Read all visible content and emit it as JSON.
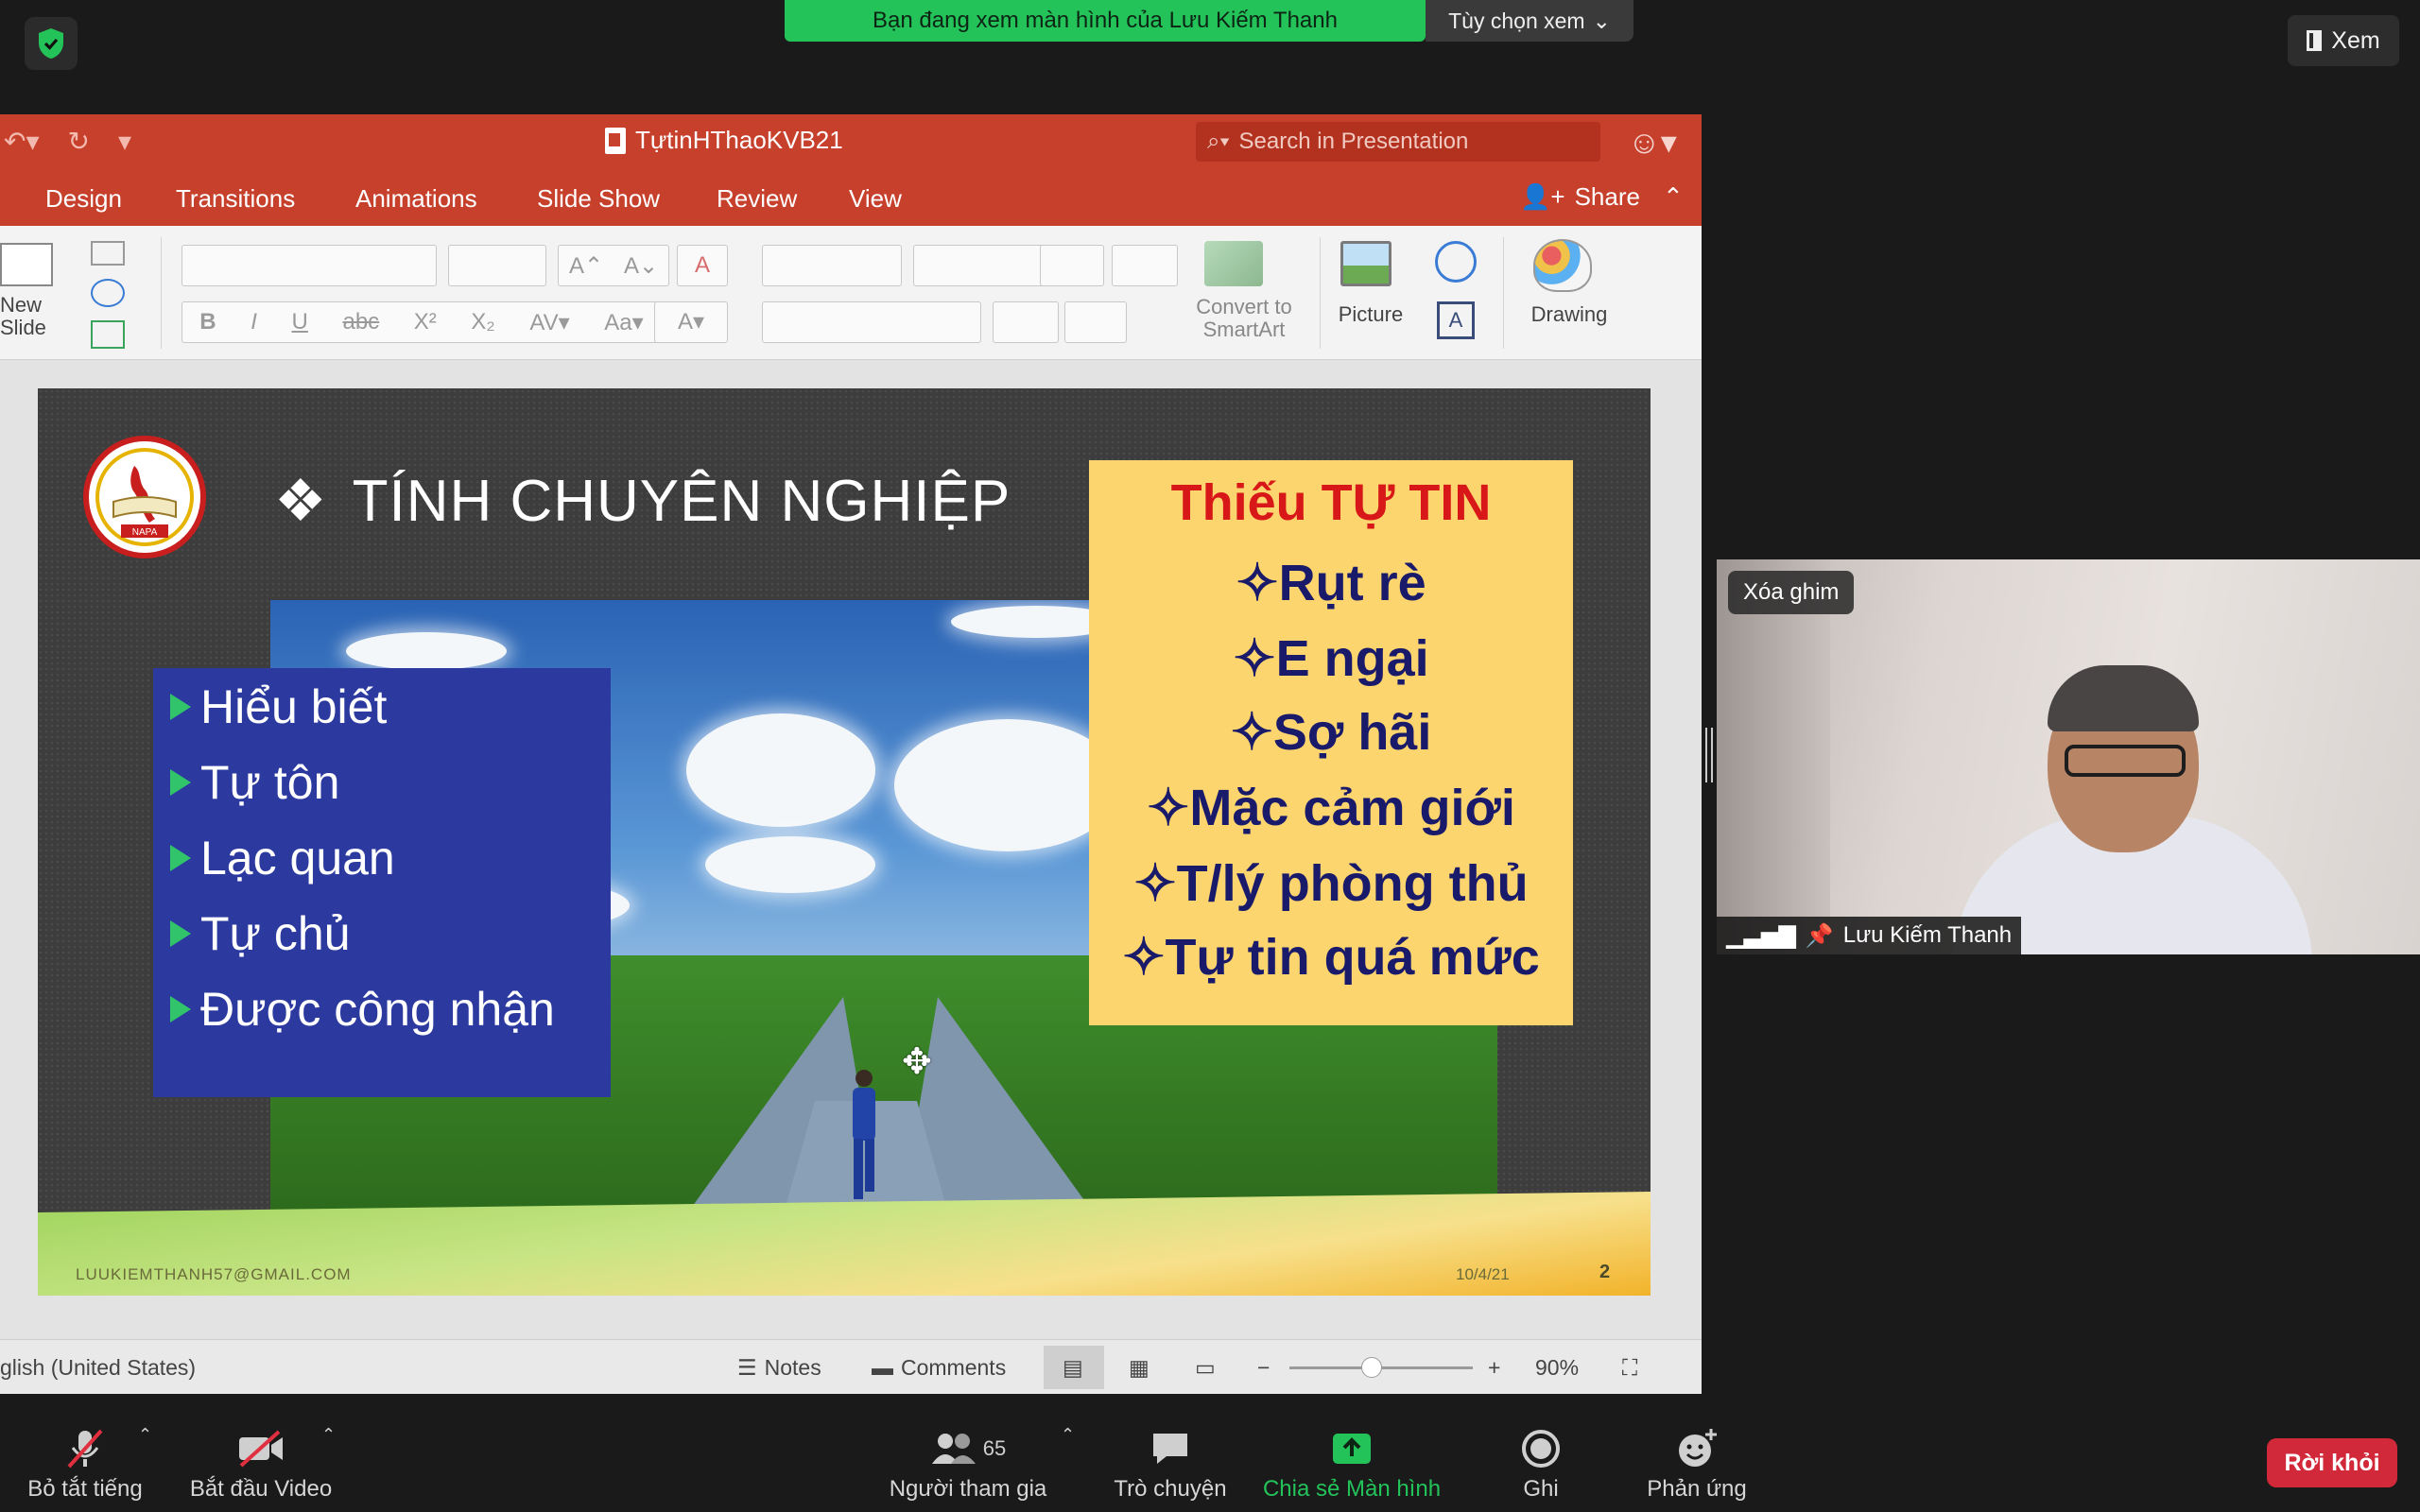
{
  "zoom": {
    "banner_text": "Bạn đang xem màn hình của Lưu Kiếm Thanh",
    "view_options": "Tùy chọn xem",
    "view_button": "Xem",
    "toolbar": {
      "mute": "Bỏ tắt tiếng",
      "video": "Bắt đầu Video",
      "participants": "Người tham gia",
      "participants_count": "65",
      "chat": "Trò chuyện",
      "share": "Chia sẻ Màn hình",
      "record": "Ghi",
      "reactions": "Phản ứng",
      "leave": "Rời khỏi"
    },
    "video_tile": {
      "unpin": "Xóa ghim",
      "name": "Lưu Kiếm Thanh"
    },
    "colors": {
      "banner": "#23c35a",
      "leave": "#d2293a",
      "share_icon": "#23c35a"
    }
  },
  "ppt": {
    "title": "TựtinHThaoKVB21",
    "search_placeholder": "Search in Presentation",
    "tabs": [
      "Design",
      "Transitions",
      "Animations",
      "Slide Show",
      "Review",
      "View"
    ],
    "share": "Share",
    "ribbon": {
      "new_slide": "New Slide",
      "convert": "Convert to SmartArt",
      "picture": "Picture",
      "drawing": "Drawing"
    },
    "status": {
      "language": "glish (United States)",
      "notes": "Notes",
      "comments": "Comments",
      "zoom": "90%"
    },
    "accent": "#c6402c"
  },
  "slide": {
    "heading": "TÍNH CHUYÊN NGHIỆP",
    "left_items": [
      "Hiểu biết",
      "Tự tôn",
      "Lạc quan",
      "Tự chủ",
      "Được công nhận"
    ],
    "right_title": "Thiếu TỰ TIN",
    "right_items": [
      "✧Rụt rè",
      "✧E ngại",
      "✧Sợ hãi",
      "✧Mặc cảm giới",
      "✧T/lý phòng thủ",
      "✧Tự tin quá mức"
    ],
    "email": "LUUKIEMTHANH57@GMAIL.COM",
    "date": "10/4/21",
    "number": "2",
    "logo_text": "NAPA"
  }
}
